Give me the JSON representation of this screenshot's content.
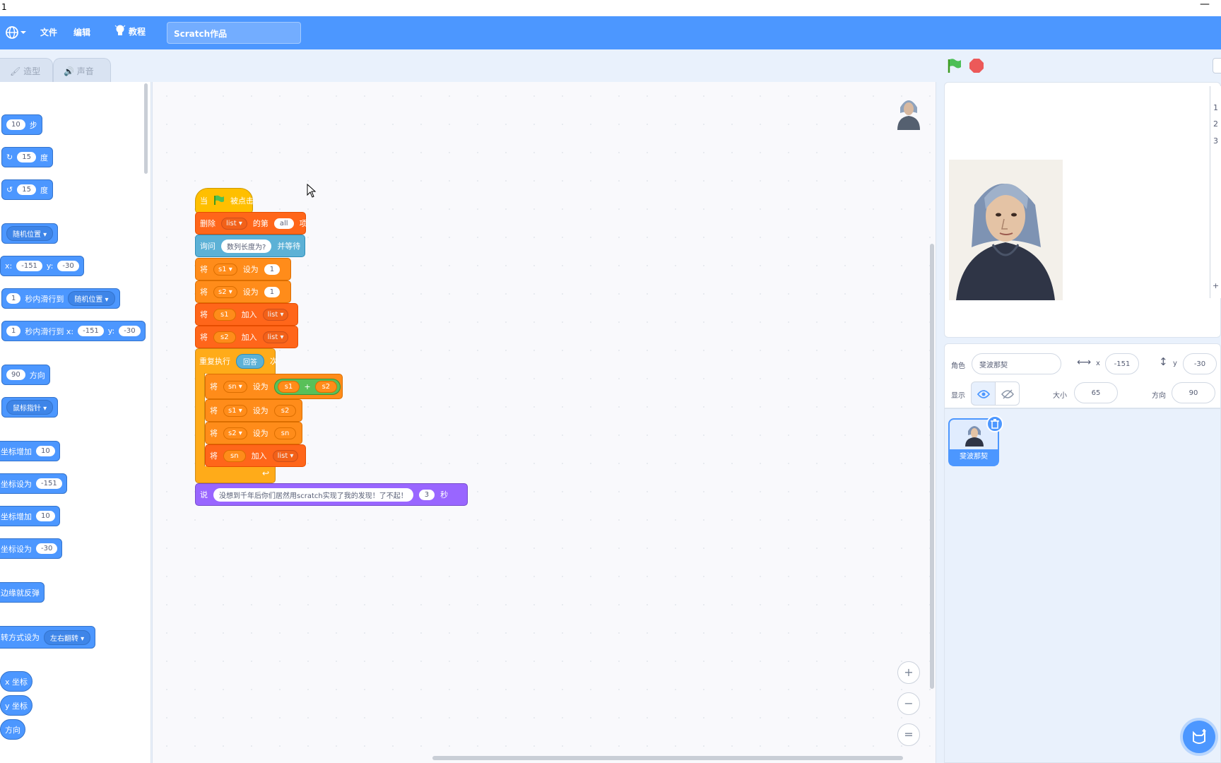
{
  "window": {
    "title": "1",
    "minimize": "—"
  },
  "menubar": {
    "file": "文件",
    "edit": "编辑",
    "tutorials": "教程",
    "project_title": "Scratch作品"
  },
  "tabs": {
    "costumes": "造型",
    "sounds": "声音"
  },
  "palette": {
    "move_steps": {
      "value": "10",
      "text": "步"
    },
    "turn_right": {
      "value": "15",
      "text": "度"
    },
    "turn_left": {
      "value": "15",
      "text": "度"
    },
    "goto_random": "随机位置",
    "goto_xy": {
      "x_label": "x:",
      "x": "-151",
      "y_label": "y:",
      "y": "-30"
    },
    "glide_random": {
      "value": "1",
      "text": "秒内滑行到",
      "target": "随机位置"
    },
    "glide_xy": {
      "value": "1",
      "text": "秒内滑行到 x:",
      "x": "-151",
      "y_label": "y:",
      "y": "-30"
    },
    "point_direction": {
      "value": "90",
      "text": "方向"
    },
    "point_towards": "鼠标指针",
    "change_x": {
      "text": "坐标增加",
      "value": "10"
    },
    "set_x": {
      "text": "坐标设为",
      "value": "-151"
    },
    "change_y": {
      "text": "坐标增加",
      "value": "10"
    },
    "set_y": {
      "text": "坐标设为",
      "value": "-30"
    },
    "bounce": "边缘就反弹",
    "rotation_style": {
      "text": "转方式设为",
      "value": "左右翻转"
    },
    "x_position": "x 坐标",
    "y_position": "y 坐标",
    "direction": "方向"
  },
  "script": {
    "hat": {
      "when": "当",
      "clicked": "被点击"
    },
    "delete": {
      "text": "删除",
      "list": "list",
      "of": "的第",
      "index": "all",
      "item": "项"
    },
    "ask": {
      "text": "询问",
      "question": "数列长度为?",
      "wait": "并等待"
    },
    "set_s1": {
      "set": "将",
      "var": "s1",
      "to": "设为",
      "value": "1"
    },
    "set_s2": {
      "set": "将",
      "var": "s2",
      "to": "设为",
      "value": "1"
    },
    "add_s1": {
      "set": "将",
      "var": "s1",
      "add": "加入",
      "list": "list"
    },
    "add_s2": {
      "set": "将",
      "var": "s2",
      "add": "加入",
      "list": "list"
    },
    "repeat": {
      "text": "重复执行",
      "value": "回答",
      "times": "次"
    },
    "set_sn": {
      "set": "将",
      "var": "sn",
      "to": "设为",
      "a": "s1",
      "op": "+",
      "b": "s2"
    },
    "set_s1_s2": {
      "set": "将",
      "var": "s1",
      "to": "设为",
      "value": "s2"
    },
    "set_s2_sn": {
      "set": "将",
      "var": "s2",
      "to": "设为",
      "value": "sn"
    },
    "add_sn": {
      "set": "将",
      "var": "sn",
      "add": "加入",
      "list": "list"
    },
    "say": {
      "text": "说",
      "message": "没想到千年后你们居然用scratch实现了我的发现！了不起！",
      "secs": "3",
      "unit": "秒"
    }
  },
  "zoom": {
    "in": "+",
    "out": "−",
    "reset": "="
  },
  "stage_list_rows": [
    "1",
    "2",
    "3"
  ],
  "stage_list_add": "+",
  "sprite_info": {
    "sprite_label": "角色",
    "sprite_name": "斐波那契",
    "x_label": "x",
    "x": "-151",
    "y_label": "y",
    "y": "-30",
    "show_label": "显示",
    "size_label": "大小",
    "size": "65",
    "direction_label": "方向",
    "direction": "90"
  },
  "sprite_tile": {
    "name": "斐波那契"
  },
  "colors": {
    "menubar": "#4c97ff",
    "motion": "#4c97ff",
    "events": "#ffbf00",
    "list": "#ff661a",
    "variables": "#ff8c1a",
    "sensing": "#5cb1d6",
    "looks": "#9966ff",
    "control": "#ffab19",
    "operators": "#59c059"
  }
}
